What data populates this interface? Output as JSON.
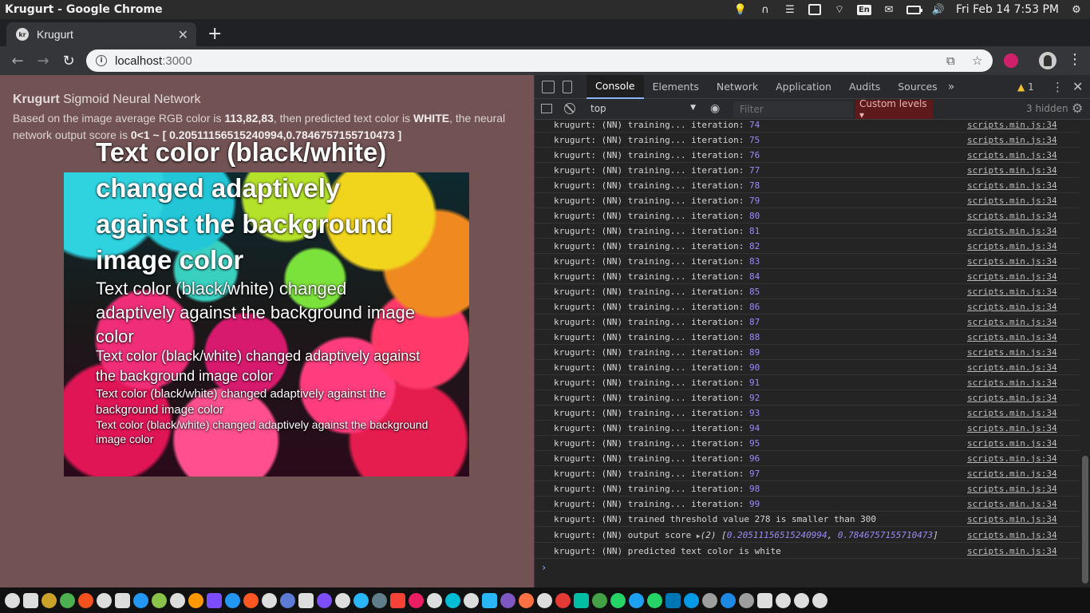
{
  "os": {
    "app_title": "Krugurt - Google Chrome",
    "keyboard_layout": "En",
    "clock": "Fri Feb 14  7:53 PM",
    "tray_icons": [
      "lightbulb-icon",
      "shelf-icon",
      "list-icon",
      "copy-icon",
      "wifi-icon",
      "keyboard-layout-icon",
      "mail-icon",
      "battery-icon",
      "volume-icon",
      "settings-icon"
    ]
  },
  "browser": {
    "tab_title": "Krugurt",
    "favicon_text": "kr",
    "url_host": "localhost",
    "url_port": ":3000",
    "accent": "#d0206a"
  },
  "page": {
    "title_bold": "Krugurt",
    "title_rest": " Sigmoid Neural Network",
    "desc_prefix": "Based on the image average RGB color is ",
    "rgb": "113,82,83",
    "desc_mid": ", then predicted text color is ",
    "predicted": "WHITE",
    "desc_mid2": ", the neural network output score is ",
    "score": "0<1 ~ [ 0.20511156515240994,0.7846757155710473 ]",
    "background_color": "#725253",
    "hero_texts": [
      "Text color (black/white) changed adaptively against the background image color",
      "Text color (black/white) changed adaptively against the background image color",
      "Text color (black/white) changed adaptively against the background image color",
      "Text color (black/white) changed adaptively against the background image color",
      "Text color (black/white) changed adaptively against the background image color"
    ]
  },
  "devtools": {
    "tabs": [
      "Console",
      "Elements",
      "Network",
      "Application",
      "Audits",
      "Sources"
    ],
    "active_tab": "Console",
    "more": "»",
    "warning_count": "1",
    "context": "top",
    "filter_placeholder": "Filter",
    "levels_label": "Custom levels ▾",
    "hidden": "3 hidden",
    "source": "scripts.min.js:34",
    "prefix": "krugurt: (NN) training... iteration: ",
    "iterations": [
      "74",
      "75",
      "76",
      "77",
      "78",
      "79",
      "80",
      "81",
      "82",
      "83",
      "84",
      "85",
      "86",
      "87",
      "88",
      "89",
      "90",
      "91",
      "92",
      "93",
      "94",
      "95",
      "96",
      "97",
      "98",
      "99"
    ],
    "threshold_msg": "krugurt: (NN) trained threshold value 278 is smaller than 300",
    "output_prefix": "krugurt: (NN) output score ",
    "output_count": "(2) ",
    "output_open": "[",
    "output_v1": "0.20511156515240994",
    "output_sep": ", ",
    "output_v2": "0.7846757155710473",
    "output_close": "]",
    "predicted_msg": "krugurt: (NN) predicted text color is white",
    "prompt": "›"
  },
  "dock": {
    "icon_colors": [
      "#ddd",
      "#ddd",
      "#c9a227",
      "#4caf50",
      "#f4511e",
      "#ddd",
      "#ddd",
      "#2196f3",
      "#8bc34a",
      "#ddd",
      "#ff9800",
      "#7c4dff",
      "#2196f3",
      "#ff5722",
      "#ddd",
      "#5b7bd5",
      "#ddd",
      "#7c4dff",
      "#ddd",
      "#29b6f6",
      "#607d8b",
      "#f44336",
      "#e91e63",
      "#ddd",
      "#00bcd4",
      "#ddd",
      "#29b6f6",
      "#7e57c2",
      "#ff7043",
      "#ddd",
      "#e53935",
      "#00bfa5",
      "#43a047",
      "#25d366",
      "#1da1f2",
      "#25d366",
      "#0077b5",
      "#039be5",
      "#9e9e9e",
      "#1e88e5",
      "#9e9e9e",
      "#ddd",
      "#ddd",
      "#ddd",
      "#ddd"
    ]
  }
}
